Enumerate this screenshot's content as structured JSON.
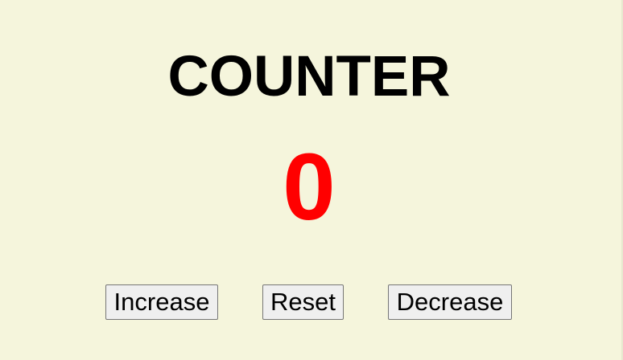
{
  "title": "COUNTER",
  "counter": {
    "value": "0",
    "color": "#ff0000"
  },
  "buttons": {
    "increase": "Increase",
    "reset": "Reset",
    "decrease": "Decrease"
  },
  "colors": {
    "background": "#f5f5dc",
    "title": "#000000",
    "button_background": "#efefef",
    "button_border": "#767676"
  }
}
